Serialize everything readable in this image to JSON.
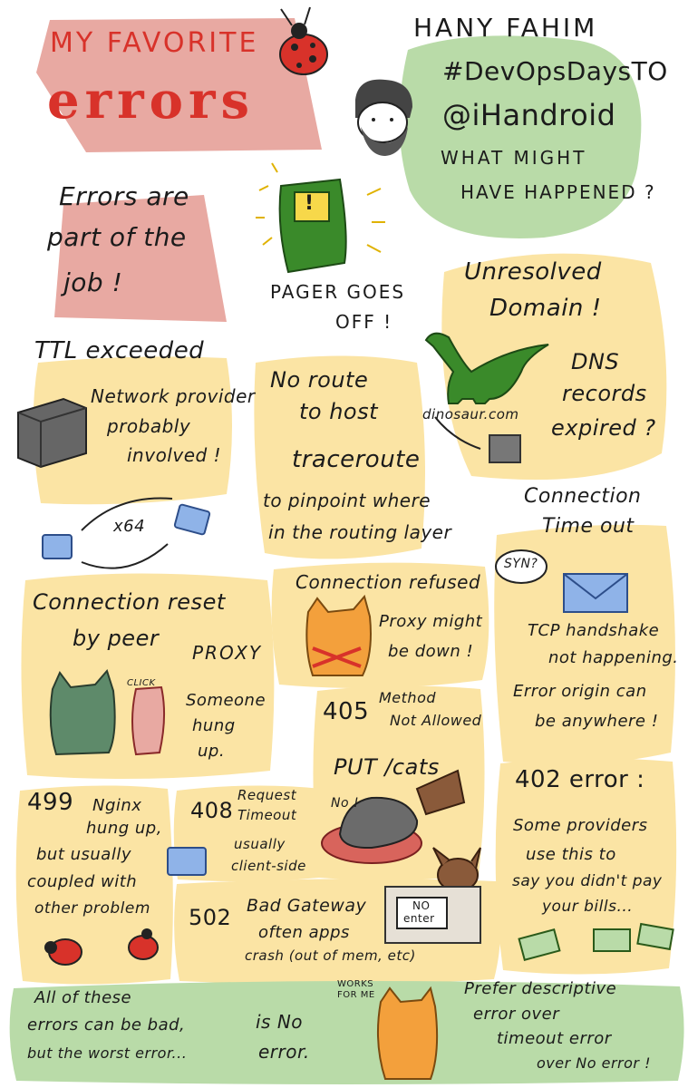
{
  "title": {
    "line1": "MY FAVORITE",
    "line2": "errors"
  },
  "speaker": {
    "name": "HANY FAHIM",
    "event": "#DevOpsDaysTO",
    "handle": "@iHandroid",
    "question_line1": "WHAT MIGHT",
    "question_line2": "HAVE HAPPENED ?"
  },
  "intro": {
    "line1": "Errors are",
    "line2": "part of the",
    "line3": "job !"
  },
  "pager": {
    "line1": "PAGER GOES",
    "line2": "OFF !",
    "badge": "!"
  },
  "ttl": {
    "title": "TTL exceeded",
    "line1": "Network provider",
    "line2": "probably",
    "line3": "involved !",
    "hops": "x64"
  },
  "no_route": {
    "title1": "No route",
    "title2": "to host",
    "tool": "traceroute",
    "desc1": "to pinpoint where",
    "desc2": "in the routing layer"
  },
  "dns": {
    "title1": "Unresolved",
    "title2": "Domain !",
    "domain": "dinosaur.com",
    "desc1": "DNS",
    "desc2": "records",
    "desc3": "expired ?"
  },
  "timeout": {
    "title1": "Connection",
    "title2": "Time out",
    "syn": "SYN?",
    "desc1": "TCP handshake",
    "desc2": "not happening.",
    "desc3": "Error origin can",
    "desc4": "be anywhere !"
  },
  "reset": {
    "title1": "Connection reset",
    "title2": "by peer",
    "proxy": "PROXY",
    "click": "CLICK",
    "desc1": "Someone",
    "desc2": "hung",
    "desc3": "up."
  },
  "refused": {
    "title": "Connection refused",
    "desc1": "Proxy might",
    "desc2": "be down !"
  },
  "e405": {
    "code": "405",
    "label1": "Method",
    "label2": "Not Allowed",
    "request": "PUT /cats",
    "no": "No !"
  },
  "e499": {
    "code": "499",
    "desc1": "Nginx",
    "desc2": "hung up,",
    "desc3": "but usually",
    "desc4": "coupled with",
    "desc5": "other problem"
  },
  "e408": {
    "code": "408",
    "label1": "Request",
    "label2": "Timeout",
    "desc1": "usually",
    "desc2": "client-side"
  },
  "e502": {
    "code": "502",
    "label": "Bad Gateway",
    "desc1": "often apps",
    "desc2": "crash (out of mem, etc)",
    "sign1": "NO",
    "sign2": "enter"
  },
  "e402": {
    "code": "402 error :",
    "desc1": "Some providers",
    "desc2": "use this to",
    "desc3": "say you didn't pay",
    "desc4": "your bills..."
  },
  "footer": {
    "left1": "All of these",
    "left2": "errors can be bad,",
    "left3": "but the worst error...",
    "mid1": "is No",
    "mid2": "error.",
    "works": "WORKS FOR ME",
    "right1": "Prefer descriptive",
    "right2": "error over",
    "right3": "timeout error",
    "right4": "over No error !"
  },
  "colors": {
    "pink": "#e8a9a2",
    "yellow": "#fbe4a4",
    "green": "#b9dba8",
    "red": "#d8322a",
    "blue": "#8fb3e8"
  }
}
